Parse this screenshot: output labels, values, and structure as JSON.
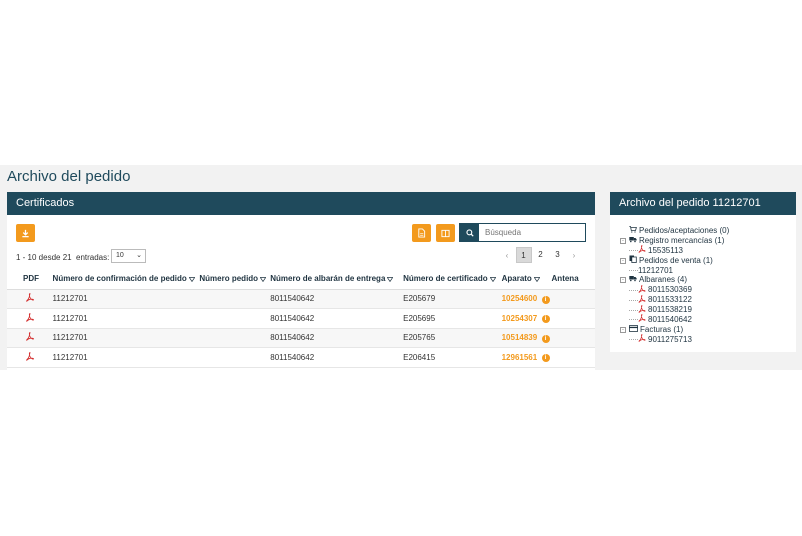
{
  "page": {
    "title": "Archivo del pedido"
  },
  "left_panel": {
    "header": "Certificados",
    "search_placeholder": "Búsqueda",
    "info_count": "1 - 10 desde 21",
    "entries_label": "entradas:",
    "entries_value": "10",
    "pager": {
      "prev": "‹",
      "next": "›",
      "pages": [
        "1",
        "2",
        "3"
      ],
      "active_page": "1"
    },
    "table": {
      "columns": [
        "PDF",
        "Número de confirmación de pedido",
        "Número pedido",
        "Número de albarán de entrega",
        "Número de certificado",
        "Aparato",
        "Antena"
      ],
      "rows": [
        {
          "confirmation": "11212701",
          "order": "",
          "delivery": "8011540642",
          "certificate": "E205679",
          "device": "10254600"
        },
        {
          "confirmation": "11212701",
          "order": "",
          "delivery": "8011540642",
          "certificate": "E205695",
          "device": "10254307"
        },
        {
          "confirmation": "11212701",
          "order": "",
          "delivery": "8011540642",
          "certificate": "E205765",
          "device": "10514839"
        },
        {
          "confirmation": "11212701",
          "order": "",
          "delivery": "8011540642",
          "certificate": "E206415",
          "device": "12961561"
        }
      ]
    }
  },
  "right_panel": {
    "header": "Archivo del pedido 11212701",
    "tree": [
      {
        "label": "Pedidos/aceptaciones (0)",
        "level": 0,
        "icon": "cart-icon",
        "toggle": ""
      },
      {
        "label": "Registro mercancías (1)",
        "level": 0,
        "icon": "truck-icon",
        "toggle": "-"
      },
      {
        "label": "15535113",
        "level": 1,
        "icon": "pdf-icon",
        "toggle": ""
      },
      {
        "label": "Pedidos de venta (1)",
        "level": 0,
        "icon": "copy-icon",
        "toggle": "-"
      },
      {
        "label": "11212701",
        "level": 1,
        "icon": "",
        "toggle": ""
      },
      {
        "label": "Albaranes (4)",
        "level": 0,
        "icon": "truck-icon",
        "toggle": "-"
      },
      {
        "label": "8011530369",
        "level": 1,
        "icon": "pdf-icon",
        "toggle": ""
      },
      {
        "label": "8011533122",
        "level": 1,
        "icon": "pdf-icon",
        "toggle": ""
      },
      {
        "label": "8011538219",
        "level": 1,
        "icon": "pdf-icon",
        "toggle": ""
      },
      {
        "label": "8011540642",
        "level": 1,
        "icon": "pdf-icon",
        "toggle": ""
      },
      {
        "label": "Facturas (1)",
        "level": 0,
        "icon": "invoice-icon",
        "toggle": "-"
      },
      {
        "label": "9011275713",
        "level": 1,
        "icon": "pdf-icon",
        "toggle": ""
      }
    ]
  },
  "colors": {
    "header_bg": "#1f4a5c",
    "accent": "#f39a1d",
    "pdf_red": "#d32f2f"
  }
}
